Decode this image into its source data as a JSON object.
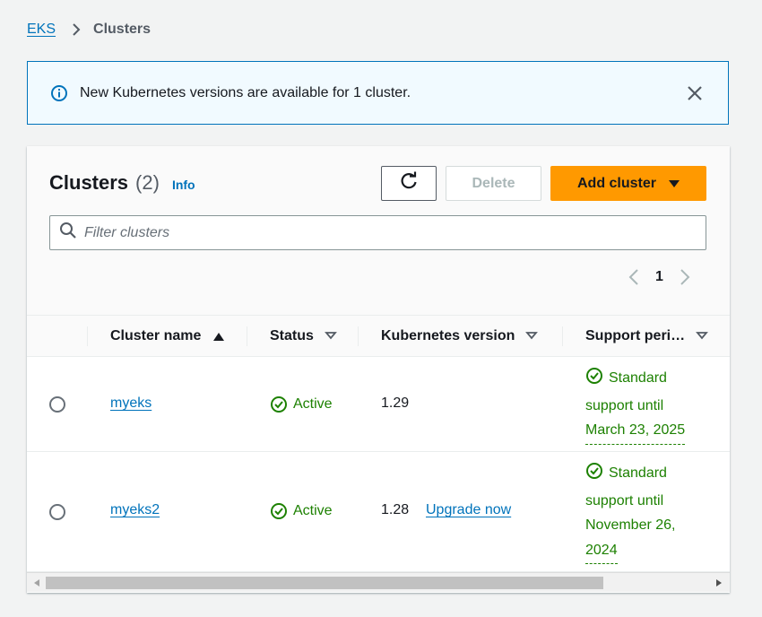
{
  "breadcrumb": {
    "root": "EKS",
    "current": "Clusters"
  },
  "flash": {
    "message": "New Kubernetes versions are available for 1 cluster.",
    "icon": "info-icon",
    "close_icon": "close-icon"
  },
  "clusters": {
    "title": "Clusters",
    "count": "(2)",
    "info_label": "Info",
    "buttons": {
      "refresh_icon": "refresh-icon",
      "delete": "Delete",
      "add": "Add cluster"
    },
    "filter": {
      "placeholder": "Filter clusters",
      "value": ""
    },
    "pagination": {
      "current_page": "1"
    },
    "columns": [
      "Cluster name",
      "Status",
      "Kubernetes version",
      "Support peri…"
    ],
    "rows": [
      {
        "name": "myeks",
        "status": "Active",
        "version": "1.29",
        "upgrade": "",
        "support_lines": [
          "Standard",
          "support until",
          "March 23, 2025"
        ]
      },
      {
        "name": "myeks2",
        "status": "Active",
        "version": "1.28",
        "upgrade": "Upgrade now",
        "support_lines": [
          "Standard",
          "support until",
          "November 26,",
          "2024"
        ]
      }
    ]
  },
  "colors": {
    "link": "#0073bb",
    "primary_button": "#ff9900",
    "success": "#1d8102",
    "flash_bg": "#f1faff"
  }
}
